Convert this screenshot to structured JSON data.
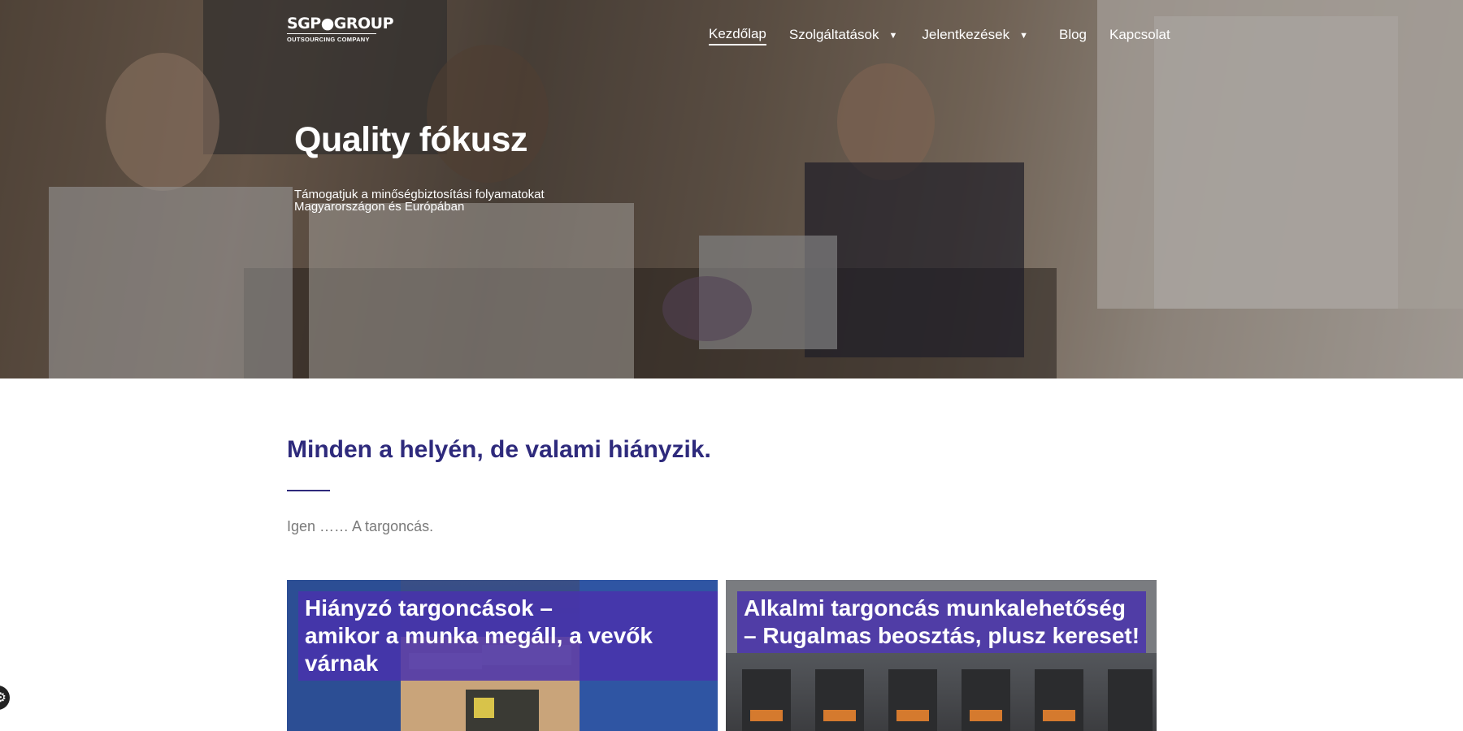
{
  "brand": {
    "logo_main": "SGP●GROUP",
    "logo_sub": "OUTSOURCING COMPANY"
  },
  "nav": {
    "items": [
      {
        "label": "Kezdőlap",
        "active": true,
        "has_dropdown": false
      },
      {
        "label": "Szolgáltatások",
        "active": false,
        "has_dropdown": true
      },
      {
        "label": "Jelentkezések",
        "active": false,
        "has_dropdown": true
      },
      {
        "label": "Blog",
        "active": false,
        "has_dropdown": false
      },
      {
        "label": "Kapcsolat",
        "active": false,
        "has_dropdown": false
      }
    ],
    "caret_icon": "caret-down-icon"
  },
  "hero": {
    "title": "Quality fókusz",
    "subtitle_line1": "Támogatjuk a minőségbiztosítási folyamatokat",
    "subtitle_line2": "Magyarországon és Európában"
  },
  "intro": {
    "title": "Minden a helyén, de valami hiányzik.",
    "text": "Igen …… A targoncás."
  },
  "cards": [
    {
      "line1": "Hiányzó targoncások –",
      "line2": "amikor a munka megáll, a vevők várnak"
    },
    {
      "line1": "Alkalmi targoncás munkalehetőség",
      "line2": "– Rugalmas beosztás, plusz kereset!"
    }
  ],
  "colors": {
    "brand_purple": "#2e2a7c",
    "caption_purple": "#4933ad",
    "muted_text": "#7a7a7a"
  },
  "accessibility": {
    "icon": "accessibility-icon"
  }
}
